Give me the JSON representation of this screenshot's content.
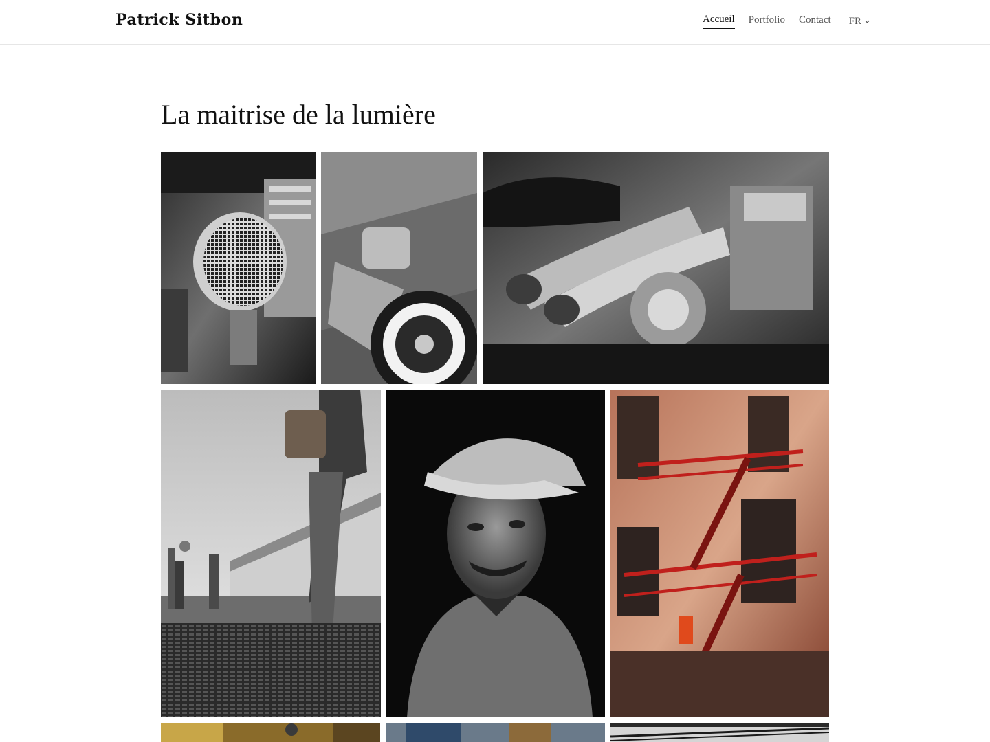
{
  "header": {
    "brand": "Patrick Sitbon",
    "nav": [
      {
        "label": "Accueil",
        "active": true
      },
      {
        "label": "Portfolio",
        "active": false
      },
      {
        "label": "Contact",
        "active": false
      }
    ],
    "language": "FR"
  },
  "main": {
    "title": "La maitrise de la lumière"
  },
  "colors": {
    "text": "#111111",
    "nav_inactive": "#555555",
    "divider": "#e6e6e6",
    "background": "#ffffff"
  }
}
